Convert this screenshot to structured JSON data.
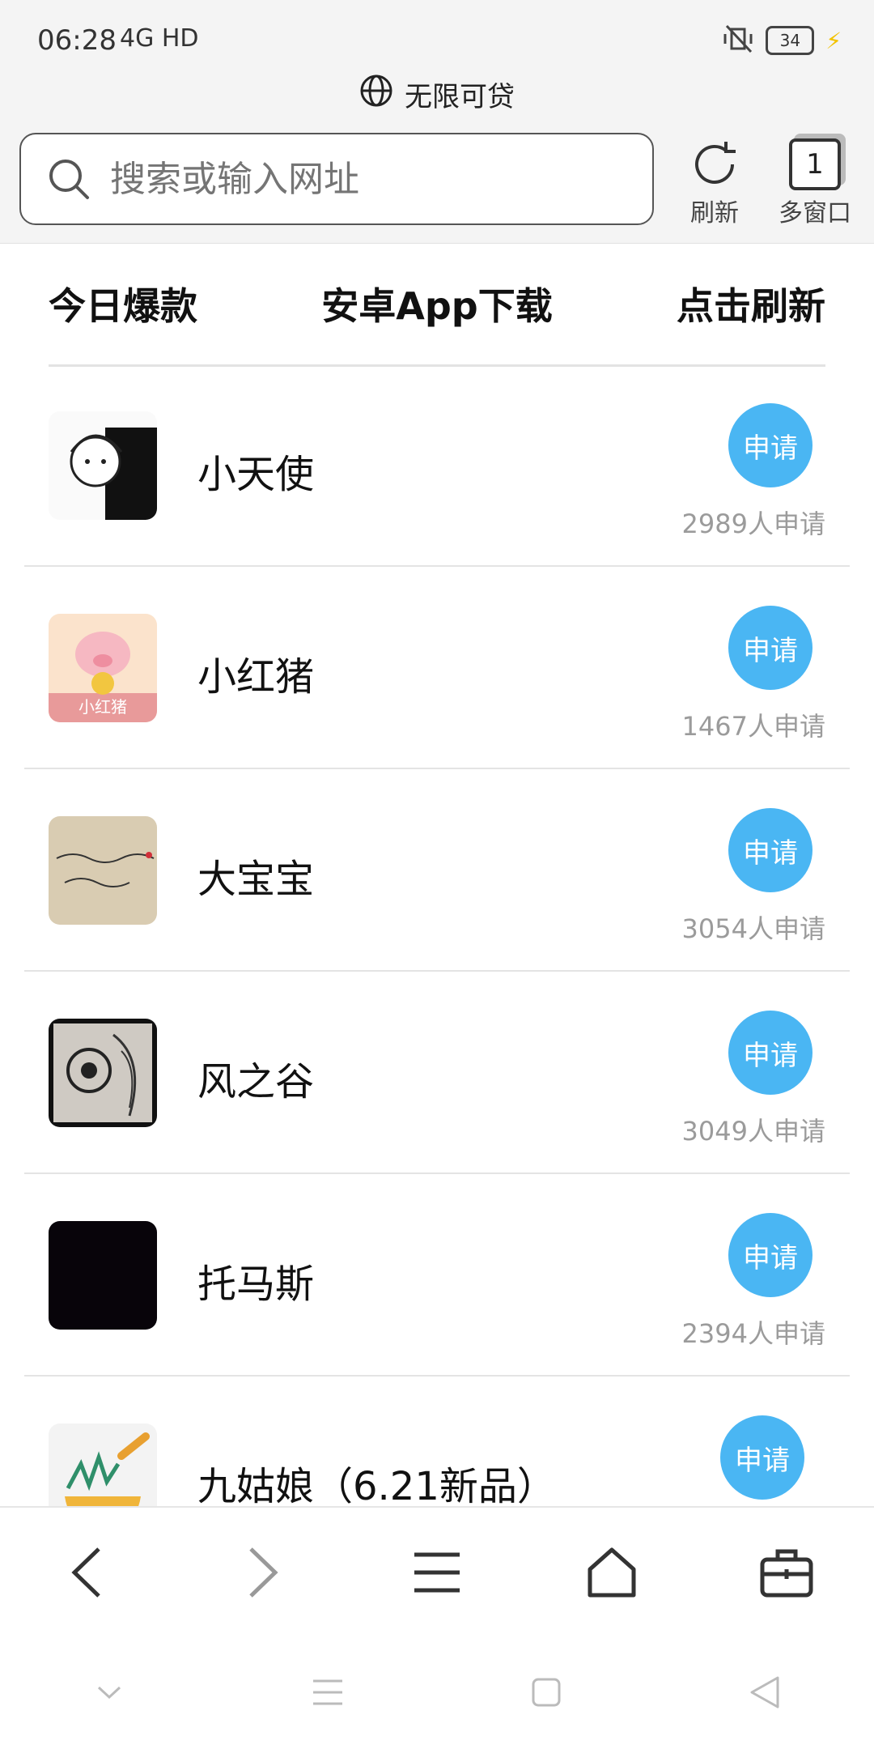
{
  "status": {
    "time": "06:28",
    "network": "4G HD",
    "battery": "34"
  },
  "page_title": "无限可贷",
  "search": {
    "placeholder": "搜索或输入网址"
  },
  "toolbar": {
    "refresh_label": "刷新",
    "windows_label": "多窗口",
    "windows_count": "1"
  },
  "tabs": [
    "今日爆款",
    "安卓App下载",
    "点击刷新"
  ],
  "apply_label": "申请",
  "items": [
    {
      "name": "小天使",
      "count_text": "2989人申请",
      "icon": "anime-girl-icon"
    },
    {
      "name": "小红猪",
      "count_text": "1467人申请",
      "icon": "red-pig-icon"
    },
    {
      "name": "大宝宝",
      "count_text": "3054人申请",
      "icon": "handwriting-icon"
    },
    {
      "name": "风之谷",
      "count_text": "3049人申请",
      "icon": "owl-drawing-icon"
    },
    {
      "name": "托马斯",
      "count_text": "2394人申请",
      "icon": "black-square-icon"
    },
    {
      "name": "九姑娘（6.21新品）",
      "count_text": "",
      "icon": "mortar-herbs-icon"
    }
  ],
  "colors": {
    "accent": "#4ab6f3",
    "muted_text": "#9b9b9b",
    "bar_bg": "#f4f4f4"
  }
}
